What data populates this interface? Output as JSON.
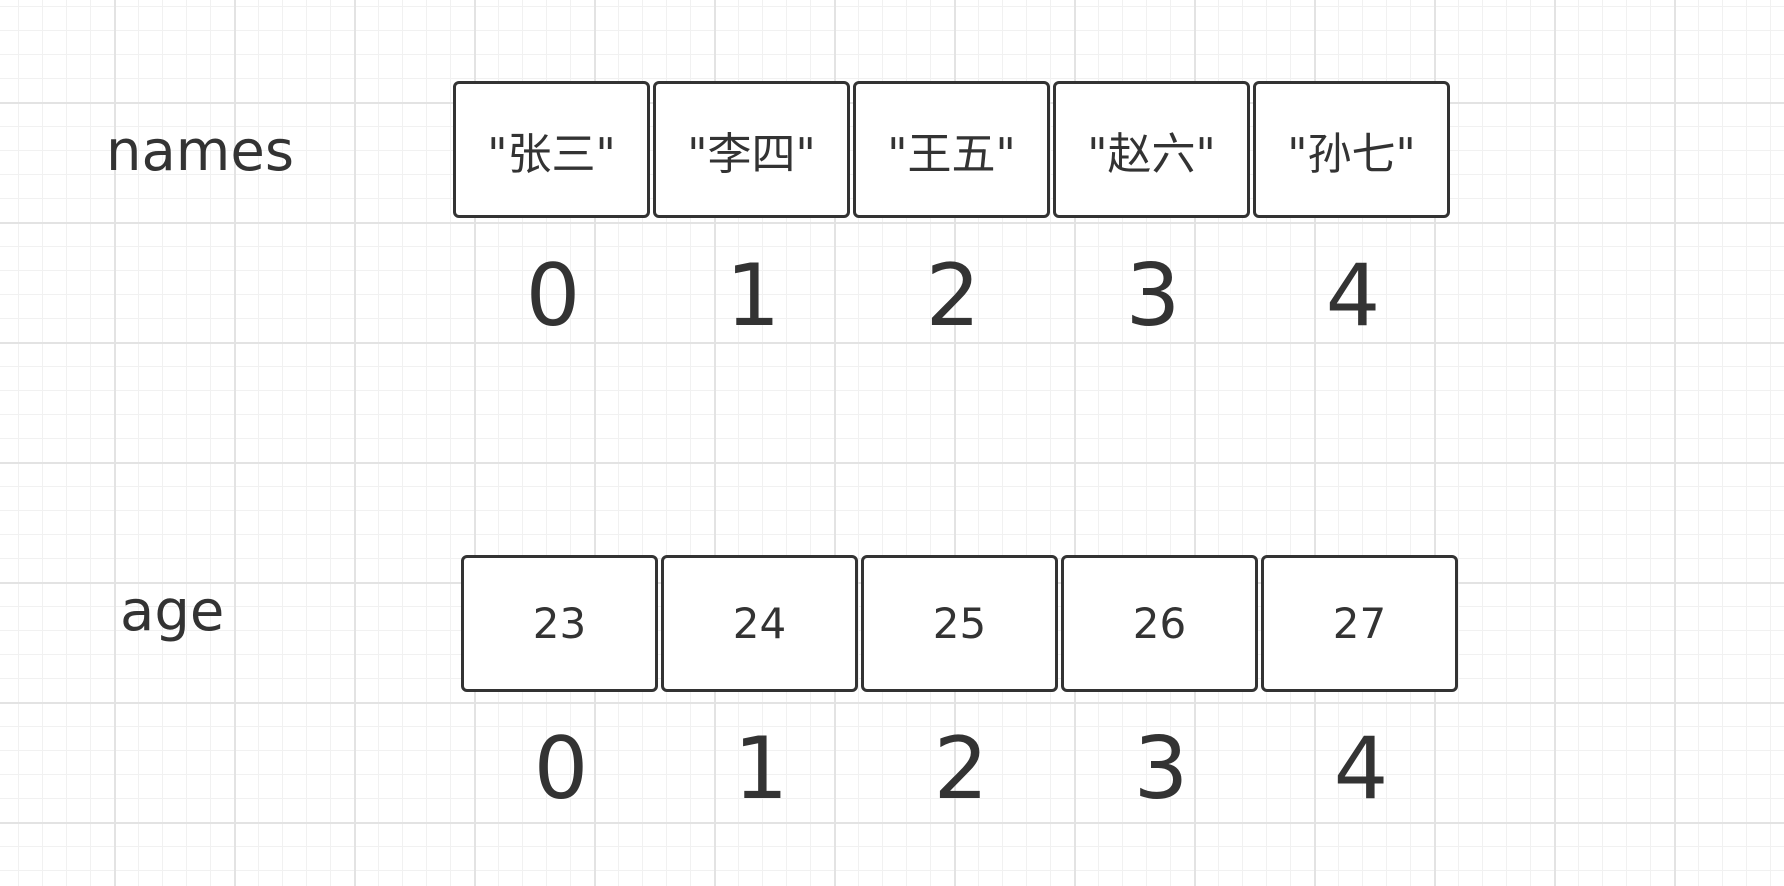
{
  "names": {
    "label": "names",
    "items": [
      "\"张三\"",
      "\"李四\"",
      "\"王五\"",
      "\"赵六\"",
      "\"孙七\""
    ],
    "indices": [
      "0",
      "1",
      "2",
      "3",
      "4"
    ]
  },
  "age": {
    "label": "age",
    "items": [
      "23",
      "24",
      "25",
      "26",
      "27"
    ],
    "indices": [
      "0",
      "1",
      "2",
      "3",
      "4"
    ]
  }
}
